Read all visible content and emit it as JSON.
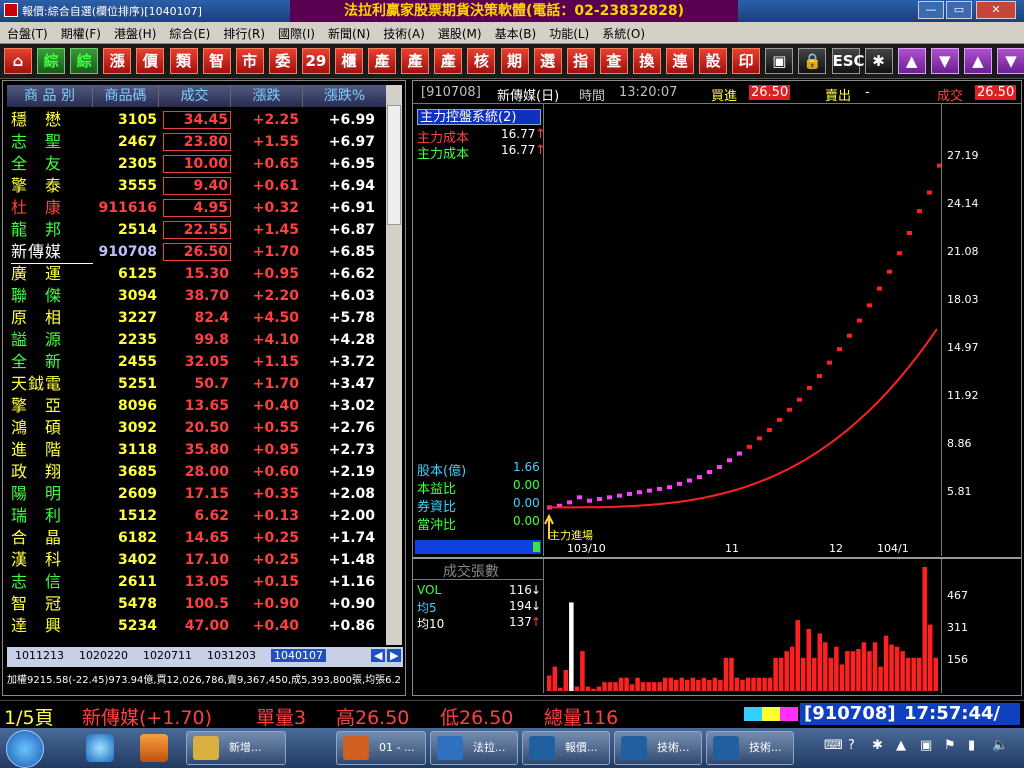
{
  "window": {
    "title": "報價:綜合自選(欄位排序)[1040107]",
    "brand_banner": "法拉利贏家股票期貨決策軟體(電話：02-23832828)",
    "minimize_label": "—",
    "maximize_label": "▭",
    "close_label": "✕"
  },
  "menu": [
    "台盤(T)",
    "期權(F)",
    "港盤(H)",
    "綜合(E)",
    "排行(R)",
    "國際(I)",
    "新聞(N)",
    "技術(A)",
    "選股(M)",
    "基本(B)",
    "功能(L)",
    "系統(O)"
  ],
  "toolbar": [
    {
      "label": "⌂",
      "icon": "home-icon"
    },
    {
      "label": "綜"
    },
    {
      "label": "綜"
    },
    {
      "label": "漲"
    },
    {
      "label": "價"
    },
    {
      "label": "類"
    },
    {
      "label": "智"
    },
    {
      "label": "市"
    },
    {
      "label": "委"
    },
    {
      "label": "29"
    },
    {
      "label": "櫃"
    },
    {
      "label": "產"
    },
    {
      "label": "產"
    },
    {
      "label": "產"
    },
    {
      "label": "核"
    },
    {
      "label": "期"
    },
    {
      "label": "選"
    },
    {
      "label": "指"
    },
    {
      "label": "查"
    },
    {
      "label": "換"
    },
    {
      "label": "連"
    },
    {
      "label": "設"
    },
    {
      "label": "印"
    },
    {
      "label": "▣",
      "icon": "window-icon"
    },
    {
      "label": "🔒",
      "icon": "lock-icon"
    },
    {
      "label": "ESC",
      "icon": "escape-icon"
    },
    {
      "label": "✱",
      "icon": "asterisk-icon"
    },
    {
      "label": "▲",
      "icon": "up-icon"
    },
    {
      "label": "▼",
      "icon": "down-icon"
    },
    {
      "label": "▲",
      "icon": "page-up-icon"
    },
    {
      "label": "▼",
      "icon": "page-down-icon"
    }
  ],
  "quote_table": {
    "columns": [
      "商 品 別",
      "商品碼",
      "成交",
      "漲跌",
      "漲跌%"
    ],
    "rows": [
      {
        "name": "穩　懋",
        "code": "3105",
        "price": "34.45",
        "chg": "+2.25",
        "pct": "+6.99",
        "limit": true
      },
      {
        "name": "志　聖",
        "code": "2467",
        "price": "23.80",
        "chg": "+1.55",
        "pct": "+6.97",
        "limit": true
      },
      {
        "name": "全　友",
        "code": "2305",
        "price": "10.00",
        "chg": "+0.65",
        "pct": "+6.95",
        "limit": true
      },
      {
        "name": "擎　泰",
        "code": "3555",
        "price": "9.40",
        "chg": "+0.61",
        "pct": "+6.94",
        "limit": true
      },
      {
        "name": "杜　康",
        "code": "911616",
        "price": "4.95",
        "chg": "+0.32",
        "pct": "+6.91",
        "limit": true
      },
      {
        "name": "龍　邦",
        "code": "2514",
        "price": "22.55",
        "chg": "+1.45",
        "pct": "+6.87",
        "limit": true
      },
      {
        "name": "新傳媒",
        "code": "910708",
        "price": "26.50",
        "chg": "+1.70",
        "pct": "+6.85",
        "limit": true,
        "selected": true
      },
      {
        "name": "廣　運",
        "code": "6125",
        "price": "15.30",
        "chg": "+0.95",
        "pct": "+6.62"
      },
      {
        "name": "聯　傑",
        "code": "3094",
        "price": "38.70",
        "chg": "+2.20",
        "pct": "+6.03"
      },
      {
        "name": "原　相",
        "code": "3227",
        "price": "82.4",
        "chg": "+4.50",
        "pct": "+5.78"
      },
      {
        "name": "謚　源",
        "code": "2235",
        "price": "99.8",
        "chg": "+4.10",
        "pct": "+4.28"
      },
      {
        "name": "全　新",
        "code": "2455",
        "price": "32.05",
        "chg": "+1.15",
        "pct": "+3.72"
      },
      {
        "name": "天鉞電",
        "code": "5251",
        "price": "50.7",
        "chg": "+1.70",
        "pct": "+3.47"
      },
      {
        "name": "擎　亞",
        "code": "8096",
        "price": "13.65",
        "chg": "+0.40",
        "pct": "+3.02"
      },
      {
        "name": "鴻　碩",
        "code": "3092",
        "price": "20.50",
        "chg": "+0.55",
        "pct": "+2.76"
      },
      {
        "name": "進　階",
        "code": "3118",
        "price": "35.80",
        "chg": "+0.95",
        "pct": "+2.73"
      },
      {
        "name": "政　翔",
        "code": "3685",
        "price": "28.00",
        "chg": "+0.60",
        "pct": "+2.19"
      },
      {
        "name": "陽　明",
        "code": "2609",
        "price": "17.15",
        "chg": "+0.35",
        "pct": "+2.08"
      },
      {
        "name": "瑞　利",
        "code": "1512",
        "price": "6.62",
        "chg": "+0.13",
        "pct": "+2.00"
      },
      {
        "name": "合　晶",
        "code": "6182",
        "price": "14.65",
        "chg": "+0.25",
        "pct": "+1.74"
      },
      {
        "name": "漢　科",
        "code": "3402",
        "price": "17.10",
        "chg": "+0.25",
        "pct": "+1.48"
      },
      {
        "name": "志　信",
        "code": "2611",
        "price": "13.05",
        "chg": "+0.15",
        "pct": "+1.16"
      },
      {
        "name": "智　冠",
        "code": "5478",
        "price": "100.5",
        "chg": "+0.90",
        "pct": "+0.90"
      },
      {
        "name": "達　興",
        "code": "5234",
        "price": "47.00",
        "chg": "+0.40",
        "pct": "+0.86"
      }
    ],
    "name_colors": [
      "yellow",
      "green",
      "green",
      "yellow",
      "red",
      "green",
      "white",
      "yellow",
      "green",
      "yellow",
      "green",
      "green",
      "yellow",
      "yellow",
      "yellow",
      "yellow",
      "yellow",
      "green",
      "green",
      "yellow",
      "yellow",
      "green",
      "yellow",
      "yellow"
    ]
  },
  "date_tabs": [
    "1011213",
    "1020220",
    "1020711",
    "1031203",
    "1040107"
  ],
  "ticker_text": "加權9215.58(-22.45)973.94億,買12,026,786,賣9,367,450,成5,393,800張,均張6.2",
  "chart": {
    "header": {
      "symbol": "[910708]",
      "name": "新傳媒(日)",
      "time_label": "時間",
      "time": "13:20:07",
      "bid_label": "買進",
      "bid": "26.50",
      "ask_label": "賣出",
      "ask": "-",
      "last_label": "成交",
      "last": "26.50"
    },
    "system_label": "主力控盤系統(2)",
    "legend": [
      {
        "label": "主力成本",
        "value": "16.77",
        "arrow": "↑",
        "color": "#ff4040"
      },
      {
        "label": "主力成本",
        "value": "16.77",
        "arrow": "↑",
        "color": "#40ff40"
      }
    ],
    "stats": [
      {
        "label": "股本(億)",
        "value": "1.66"
      },
      {
        "label": "本益比",
        "value": "0.00"
      },
      {
        "label": "券資比",
        "value": "0.00"
      },
      {
        "label": "當沖比",
        "value": "0.00"
      }
    ],
    "entry_label": "主力進場",
    "y_ticks": [
      "27.19",
      "24.14",
      "21.08",
      "18.03",
      "14.97",
      "11.92",
      "8.86",
      "5.81"
    ],
    "x_labels": [
      "103/10",
      "11",
      "12",
      "104/1"
    ],
    "volume_title": "成交張數",
    "volume_legend": [
      {
        "label": "VOL",
        "value": "116",
        "arrow": "↓",
        "color": "#40ff40"
      },
      {
        "label": "均5",
        "value": "194",
        "arrow": "↓",
        "color": "#40d0ff"
      },
      {
        "label": "均10",
        "value": "137",
        "arrow": "↑",
        "color": "#ffffff"
      }
    ],
    "volume_ticks": [
      "467",
      "311",
      "156"
    ],
    "price_color": "#ff40ff",
    "line_color": "#ff2020",
    "volume_color": "#ff2020"
  },
  "chart_data": {
    "type": "bar",
    "title": "",
    "series": [
      {
        "name": "VOL",
        "values": [
          70,
          110,
          15,
          95,
          400,
          20,
          180,
          20,
          10,
          20,
          40,
          40,
          40,
          60,
          60,
          30,
          60,
          40,
          40,
          40,
          40,
          60,
          60,
          50,
          60,
          50,
          60,
          50,
          60,
          50,
          60,
          50,
          150,
          150,
          60,
          50,
          60,
          60,
          60,
          60,
          60,
          150,
          150,
          180,
          200,
          320,
          150,
          280,
          150,
          260,
          220,
          150,
          200,
          120,
          180,
          180,
          190,
          220,
          180,
          220,
          110,
          250,
          210,
          200,
          180,
          150,
          150,
          150,
          560,
          300,
          150
        ]
      }
    ],
    "price_series": {
      "last_closes": [
        6.2,
        6.3,
        6.5,
        6.8,
        6.6,
        6.7,
        6.8,
        6.9,
        7.0,
        7.1,
        7.2,
        7.3,
        7.4,
        7.6,
        7.8,
        8.0,
        8.3,
        8.6,
        9.0,
        9.4,
        9.8,
        10.3,
        10.8,
        11.4,
        12.0,
        12.6,
        13.3,
        14.0,
        14.8,
        15.6,
        16.4,
        17.3,
        18.2,
        19.2,
        20.2,
        21.3,
        22.5,
        23.8,
        24.9,
        26.5
      ]
    },
    "ylim": [
      5.81,
      27.19
    ],
    "volume_ylim": [
      0,
      560
    ]
  },
  "status": {
    "page": "1/5頁",
    "stock": "新傳媒(+1.70)",
    "single_vol": "單量3",
    "high": "高26.50",
    "low": "低26.50",
    "total_vol": "總量116",
    "clock_code": "[910708]",
    "clock_time": "17:57:44/"
  },
  "taskbar": {
    "buttons": [
      {
        "label": "新增...",
        "color": "#d8b040"
      },
      {
        "label": "01 - ...",
        "color": "#d06020"
      },
      {
        "label": "法拉...",
        "color": "#3070c0"
      },
      {
        "label": "報價...",
        "color": "#2060a0"
      },
      {
        "label": "技術...",
        "color": "#2060a0"
      },
      {
        "label": "技術...",
        "color": "#2060a0"
      }
    ]
  }
}
